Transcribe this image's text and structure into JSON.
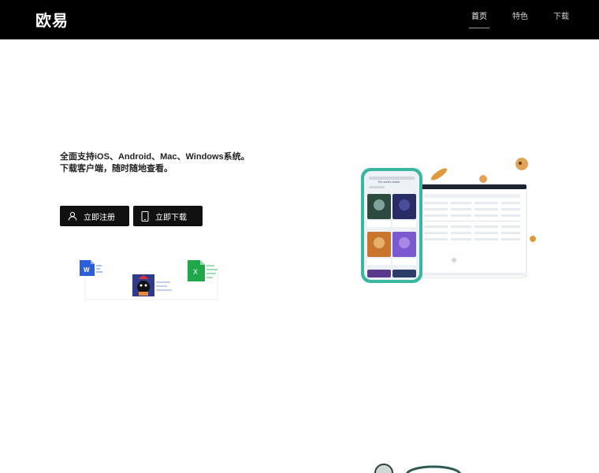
{
  "header": {
    "logo": "欧易",
    "nav": [
      {
        "label": "首页",
        "active": true
      },
      {
        "label": "特色",
        "active": false
      },
      {
        "label": "下载",
        "active": false
      }
    ]
  },
  "hero": {
    "line1": "全面支持iOS、Android、Mac、Windows系统。",
    "line2": "下载客户端，随时随地查看。",
    "register_label": "立即注册",
    "download_label": "立即下载"
  },
  "illustration": {
    "word_letter": "W",
    "excel_letter": "X",
    "word_color": "#2b5fd9",
    "excel_color": "#1fa74a"
  },
  "mockup": {
    "phone_title": "The world's leader",
    "accent": "#3ab7a0"
  }
}
